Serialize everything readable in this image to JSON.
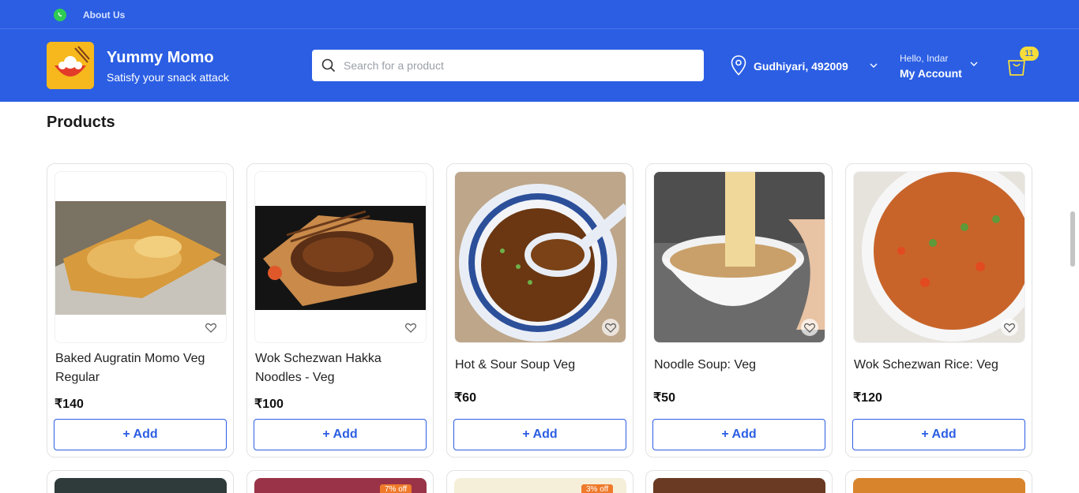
{
  "topbar": {
    "about_label": "About Us",
    "icon": "whatsapp-icon"
  },
  "brand": {
    "name": "Yummy Momo",
    "tagline": "Satisfy your snack attack"
  },
  "search": {
    "placeholder": "Search for a product",
    "value": ""
  },
  "location": {
    "label": "Gudhiyari, 492009"
  },
  "account": {
    "greeting": "Hello, Indar",
    "label": "My Account"
  },
  "cart": {
    "count": "11"
  },
  "section": {
    "title": "Products"
  },
  "colors": {
    "primary": "#2b5ee3",
    "badge": "#f5dc3a",
    "discount": "#ef7a2a"
  },
  "products": [
    {
      "name": "Baked Augratin Momo Veg Regular",
      "price": "₹140",
      "add_label": "+ Add"
    },
    {
      "name": "Wok Schezwan Hakka Noodles - Veg",
      "price": "₹100",
      "add_label": "+ Add"
    },
    {
      "name": "Hot & Sour Soup Veg",
      "price": "₹60",
      "add_label": "+ Add"
    },
    {
      "name": "Noodle Soup: Veg",
      "price": "₹50",
      "add_label": "+ Add"
    },
    {
      "name": "Wok Schezwan Rice: Veg",
      "price": "₹120",
      "add_label": "+ Add"
    }
  ],
  "next_row": {
    "badges": [
      "7% off",
      "3% off"
    ]
  }
}
